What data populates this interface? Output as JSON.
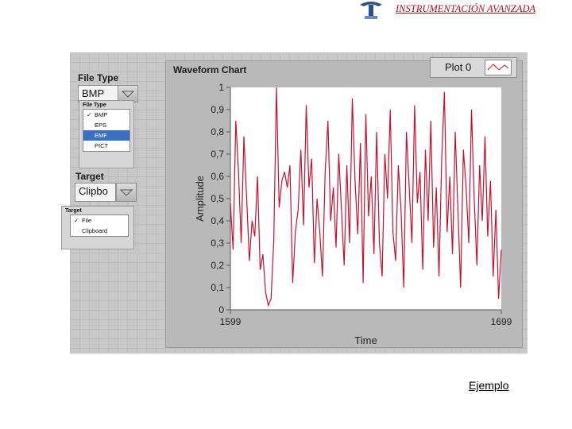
{
  "header": {
    "title": "INSTRUMENTACIÓN AVANZADA",
    "logo_icon": "institution-logo-icon"
  },
  "file_type": {
    "label": "File Type",
    "value": "BMP",
    "menu_title": "File Type",
    "options": [
      {
        "label": "BMP",
        "checked": true,
        "highlighted": false
      },
      {
        "label": "EPS",
        "checked": false,
        "highlighted": false
      },
      {
        "label": "EMF",
        "checked": false,
        "highlighted": true
      },
      {
        "label": "PICT",
        "checked": false,
        "highlighted": false
      }
    ]
  },
  "target": {
    "label": "Target",
    "value": "Clipbo",
    "menu_title": "Target",
    "options": [
      {
        "label": "File",
        "checked": true
      },
      {
        "label": "Clipboard",
        "checked": false
      }
    ]
  },
  "legend": {
    "label": "Plot 0"
  },
  "colors": {
    "trace": "#c8102e",
    "plot_bg": "#ffffff",
    "panel": "#c8c8c8",
    "menu_highlight": "#3b6fc4"
  },
  "chart_data": {
    "type": "line",
    "title": "Waveform Chart",
    "xlabel": "Time",
    "ylabel": "Amplitude",
    "xlim": [
      1599,
      1699
    ],
    "ylim": [
      0,
      1
    ],
    "x_ticks": [
      "1599",
      "1699"
    ],
    "y_ticks": [
      "0",
      "0,1",
      "0,2",
      "0,3",
      "0,4",
      "0,5",
      "0,6",
      "0,7",
      "0,8",
      "0,9",
      "1"
    ],
    "grid": false,
    "legend_position": "top-right",
    "series": [
      {
        "name": "Plot 0",
        "color": "#c8102e",
        "values": [
          0.48,
          0.27,
          0.85,
          0.62,
          0.3,
          0.78,
          0.5,
          0.22,
          0.4,
          0.33,
          0.6,
          0.18,
          0.25,
          0.08,
          0.02,
          0.05,
          0.31,
          1.0,
          0.46,
          0.58,
          0.62,
          0.55,
          0.65,
          0.12,
          0.35,
          0.45,
          0.72,
          0.38,
          0.92,
          0.55,
          0.68,
          0.21,
          0.5,
          0.35,
          0.15,
          0.62,
          0.85,
          0.4,
          0.55,
          0.28,
          0.7,
          0.45,
          0.2,
          0.65,
          0.3,
          0.95,
          0.58,
          0.34,
          0.75,
          0.12,
          0.88,
          0.42,
          0.6,
          0.25,
          0.8,
          0.3,
          0.15,
          0.7,
          0.5,
          0.9,
          0.35,
          0.22,
          0.65,
          0.45,
          0.1,
          0.8,
          0.55,
          0.3,
          0.92,
          0.48,
          0.62,
          0.18,
          0.72,
          0.4,
          0.85,
          0.28,
          0.55,
          0.15,
          0.68,
          0.98,
          0.35,
          0.6,
          0.25,
          0.8,
          0.45,
          0.1,
          0.72,
          0.55,
          0.3,
          0.9,
          0.5,
          0.2,
          0.65,
          0.4,
          0.78,
          0.33,
          0.58,
          0.15,
          0.45,
          0.05,
          0.27
        ]
      }
    ]
  },
  "footer": {
    "caption": "Ejemplo"
  }
}
